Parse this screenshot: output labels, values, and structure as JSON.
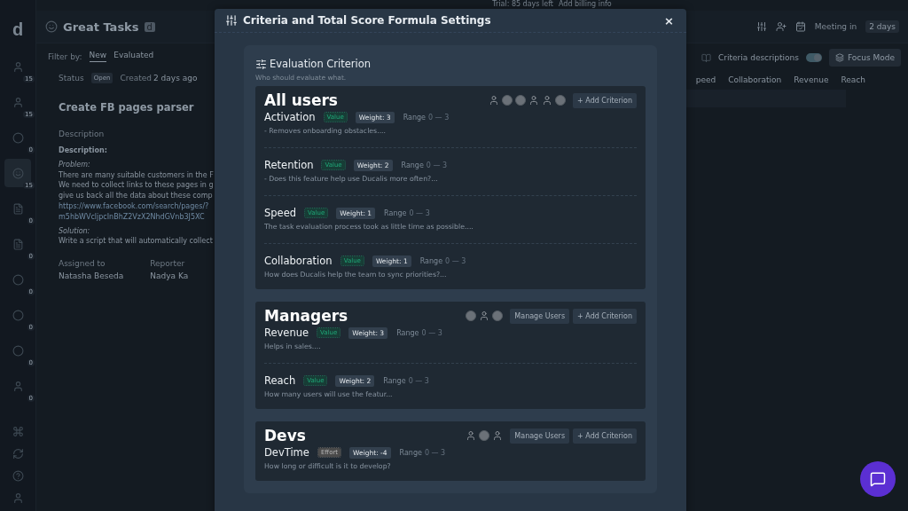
{
  "trial_bar": {
    "text": "Trial: 85 days left",
    "link": "Add billing info"
  },
  "sidebar": {
    "logo": "d",
    "items": [
      {
        "count": "15",
        "selected": false
      },
      {
        "count": "15",
        "selected": false
      },
      {
        "count": "0",
        "selected": false
      },
      {
        "count": "15",
        "selected": true
      },
      {
        "count": "0",
        "selected": false
      },
      {
        "count": "0",
        "selected": false
      },
      {
        "count": "0",
        "selected": false
      },
      {
        "count": "0",
        "selected": false
      },
      {
        "count": "0",
        "selected": false
      },
      {
        "count": "0",
        "selected": false
      }
    ]
  },
  "header": {
    "board": "Great Tasks",
    "board_badge": "d",
    "meeting_label": "Meeting in",
    "meeting_value": "2 days"
  },
  "filter": {
    "label": "Filter by:",
    "tabs": [
      {
        "label": "New",
        "selected": true
      },
      {
        "label": "Evaluated",
        "selected": false
      }
    ],
    "descriptions_label": "Criteria descriptions",
    "descriptions_on": true,
    "focus_button": "Focus Mode"
  },
  "table": {
    "columns": [
      "peed",
      "Collaboration",
      "Revenue",
      "Reach"
    ]
  },
  "task": {
    "status_label": "Status",
    "status": "Open",
    "created_label": "Created",
    "created": "2 days ago",
    "title": "Create FB pages parser",
    "description_label": "Description",
    "body": [
      {
        "kind": "bold",
        "text": "Description:"
      },
      {
        "kind": "italic",
        "text": "Problem:"
      },
      {
        "kind": "plain",
        "text": "There are many suitable customers in the F"
      },
      {
        "kind": "plain",
        "text": "We need to collect links to these pages in g"
      },
      {
        "kind": "plain",
        "text": "give us back all the data about these comp"
      },
      {
        "kind": "link",
        "text": "https://www.facebook.com/search/pages/?"
      },
      {
        "kind": "link",
        "text": "m5hbWVcljpcInBhZ2VzX2NhdGVnb3J5XC"
      },
      {
        "kind": "italic",
        "text": "Solution:"
      },
      {
        "kind": "plain",
        "text": "Write a script that will automatically collect"
      }
    ],
    "assigned_label": "Assigned to",
    "assigned": "Natasha Beseda",
    "reporter_label": "Reporter",
    "reporter": "Nadya Ka"
  },
  "modal": {
    "title": "Criteria and Total Score Formula Settings",
    "close": "×",
    "section_title": "Evaluation Criterion",
    "section_subtitle": "Who should evaluate what.",
    "groups": [
      {
        "name": "All users",
        "avatars": [
          {
            "kind": "figure"
          },
          {
            "kind": "photo"
          },
          {
            "kind": "photo"
          },
          {
            "kind": "figure"
          },
          {
            "kind": "figure"
          },
          {
            "kind": "photo"
          }
        ],
        "buttons": [
          "+ Add Criterion"
        ],
        "criteria": [
          {
            "name": "Activation",
            "tag": "Value",
            "kind": "value",
            "weight": "Weight: 3",
            "range_label": "Range",
            "range": "0 — 3",
            "description": "- Removes onboarding obstacles...."
          },
          {
            "name": "Retention",
            "tag": "Value",
            "kind": "value",
            "weight": "Weight: 2",
            "range_label": "Range",
            "range": "0 — 3",
            "description": "- Does this feature help use Ducalis more often?..."
          },
          {
            "name": "Speed",
            "tag": "Value",
            "kind": "value",
            "weight": "Weight: 1",
            "range_label": "Range",
            "range": "0 — 3",
            "description": "The task evaluation process took as little time as possible...."
          },
          {
            "name": "Collaboration",
            "tag": "Value",
            "kind": "value",
            "weight": "Weight: 1",
            "range_label": "Range",
            "range": "0 — 3",
            "description": "How does Ducalis help the team to sync priorities?..."
          }
        ]
      },
      {
        "name": "Managers",
        "avatars": [
          {
            "kind": "photo"
          },
          {
            "kind": "figure"
          },
          {
            "kind": "photo"
          }
        ],
        "buttons": [
          "Manage Users",
          "+ Add Criterion"
        ],
        "criteria": [
          {
            "name": "Revenue",
            "tag": "Value",
            "kind": "value",
            "weight": "Weight: 3",
            "range_label": "Range",
            "range": "0 — 3",
            "description": "Helps in sales...."
          },
          {
            "name": "Reach",
            "tag": "Value",
            "kind": "value",
            "weight": "Weight: 2",
            "range_label": "Range",
            "range": "0 — 3",
            "description": "How many users will use the featur..."
          }
        ]
      },
      {
        "name": "Devs",
        "avatars": [
          {
            "kind": "figure"
          },
          {
            "kind": "photo"
          },
          {
            "kind": "figure"
          }
        ],
        "buttons": [
          "Manage Users",
          "+ Add Criterion"
        ],
        "criteria": [
          {
            "name": "DevTime",
            "tag": "Effort",
            "kind": "effort",
            "weight": "Weight: -4",
            "range_label": "Range",
            "range": "0 — 3",
            "description": "How long or difficult is it to develop?"
          }
        ]
      }
    ]
  }
}
